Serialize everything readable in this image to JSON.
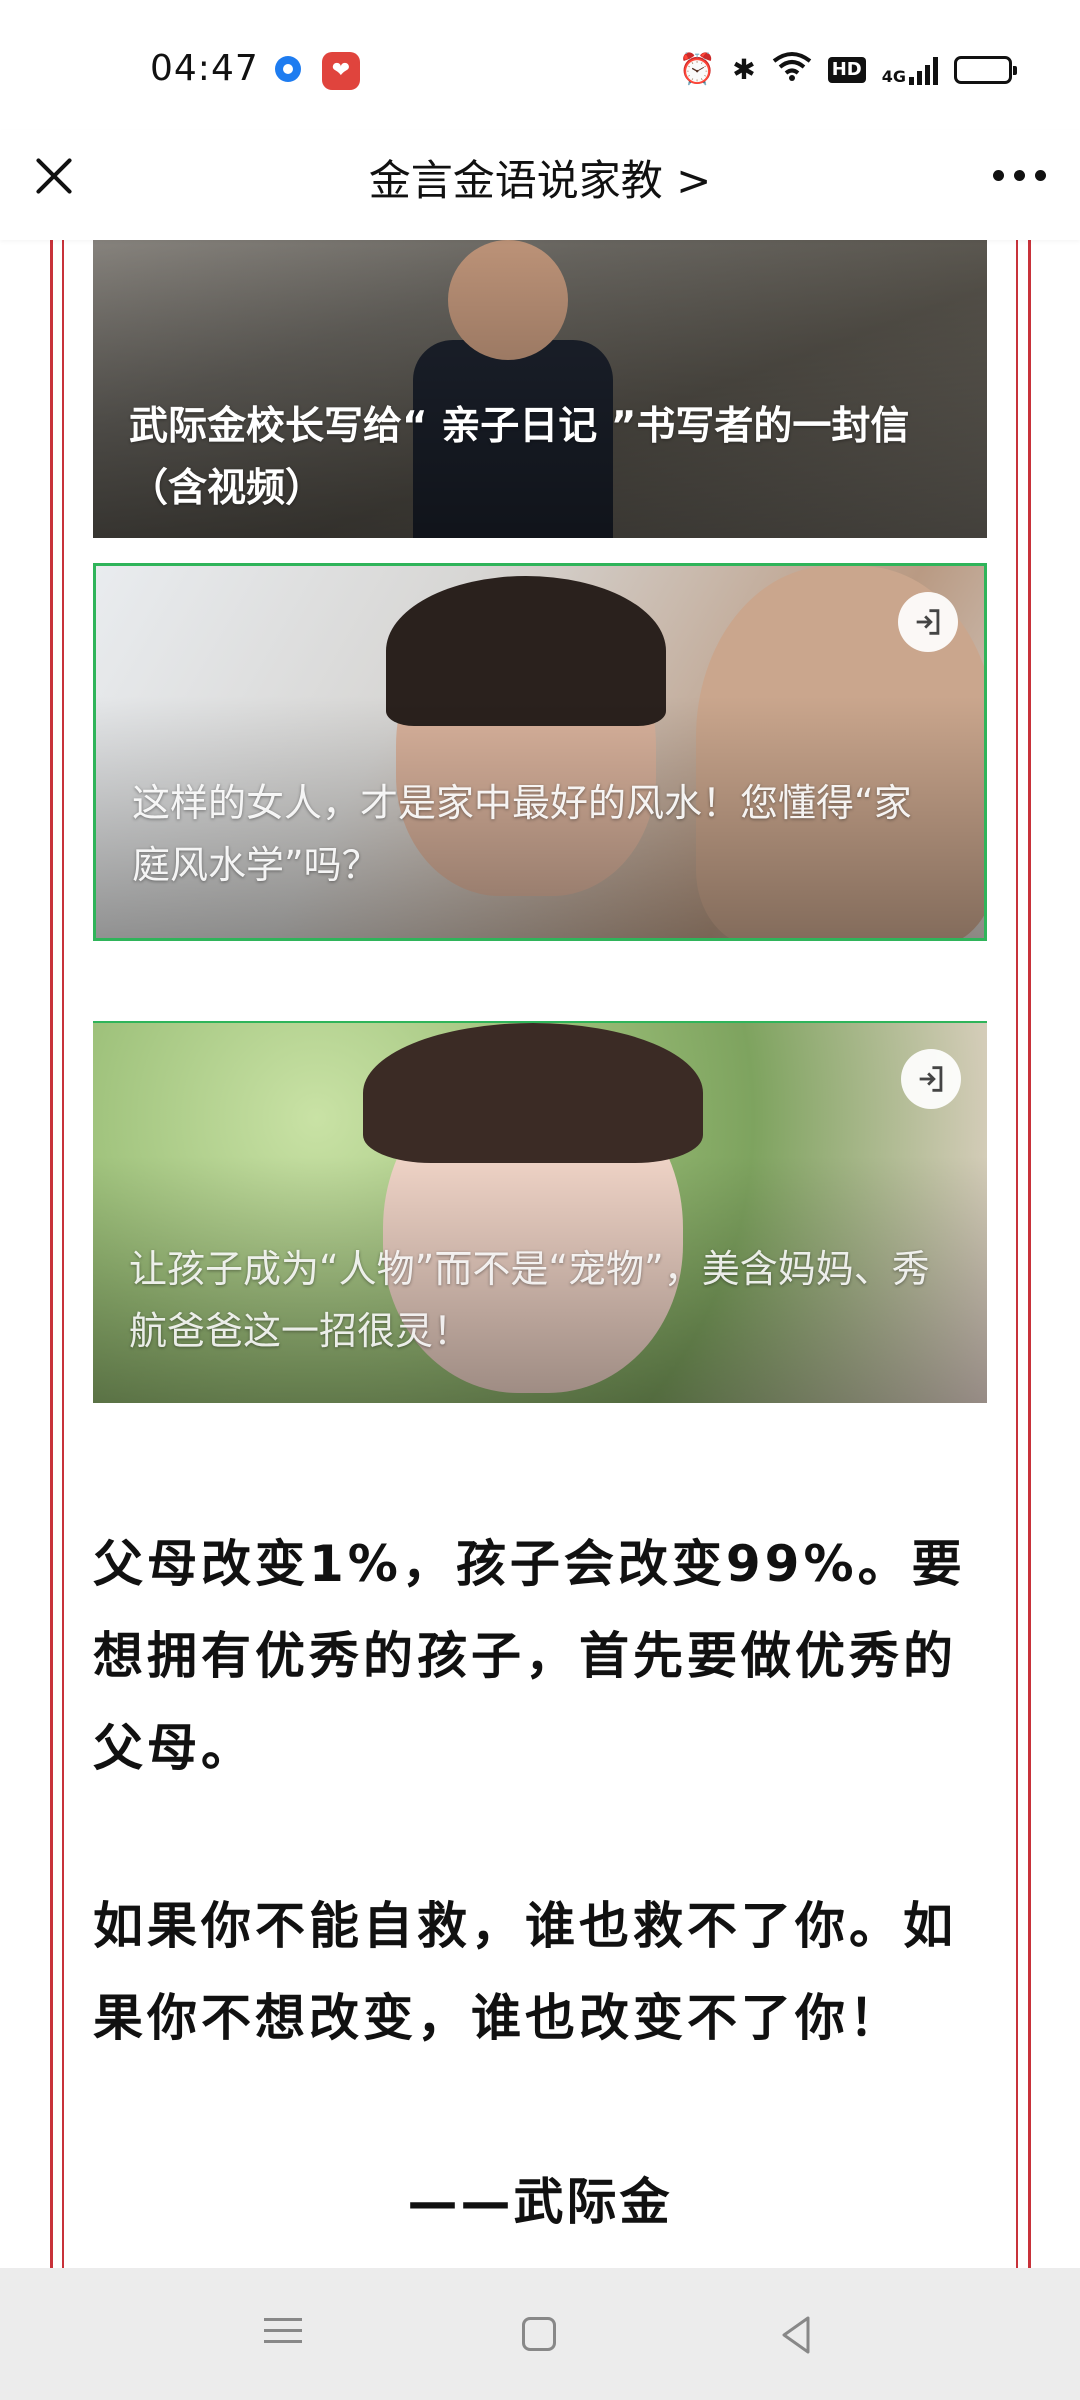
{
  "status_bar": {
    "time": "04:47",
    "icons": [
      "location-app-icon",
      "social-app-icon",
      "alarm-icon",
      "bluetooth-icon",
      "wifi-icon",
      "hd-badge",
      "signal-4g-icon",
      "battery-icon"
    ],
    "hd_label": "HD",
    "network_label": "4G"
  },
  "title_bar": {
    "title": "金言金语说家教 >",
    "close_icon": "close-icon",
    "more_icon": "more-icon"
  },
  "cards": [
    {
      "caption": "武际金校长写给“ 亲子日记 ”书写者的一封信（含视频）",
      "has_open_icon": false
    },
    {
      "caption": "这样的女人，才是家中最好的风水！您懂得“家庭风水学”吗？",
      "has_open_icon": true,
      "border_color": "#2fb45a"
    },
    {
      "caption": "让孩子成为“人物”而不是“宠物”，美含妈妈、秀航爸爸这一招很灵！",
      "has_open_icon": true
    }
  ],
  "article": {
    "para1": "父母改变1%，孩子会改变99%。要想拥有优秀的孩子，首先要做优秀的父母。",
    "para2": "如果你不能自救，谁也救不了你。如果你不想改变，谁也改变不了你！",
    "signature": "——武际金"
  },
  "colors": {
    "frame_red": "#c8323a",
    "accent_green": "#2fb45a",
    "nav_bg": "#ececec"
  },
  "nav_bar": {
    "icons": [
      "menu-icon",
      "home-icon",
      "back-icon"
    ]
  }
}
